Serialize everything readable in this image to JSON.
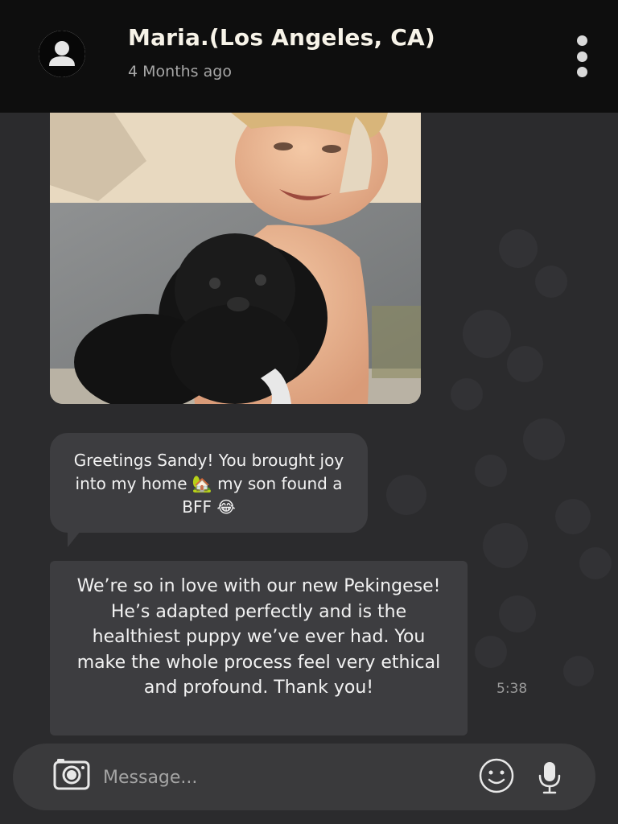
{
  "header": {
    "contact_name": "Maria.(Los Angeles, CA)",
    "last_seen": "4 Months ago",
    "avatar_icon": "person-silhouette-icon",
    "menu_icon": "vertical-ellipsis-icon"
  },
  "messages": [
    {
      "type": "image",
      "description_icon": "photo-attachment"
    },
    {
      "type": "text",
      "text": "Greetings Sandy! You brought joy into my home 🏡 my son found a BFF 😂"
    },
    {
      "type": "text",
      "text": "We’re so in love with our new Pekingese! He’s adapted perfectly and is the healthiest puppy we’ve ever had. You make the whole process feel very ethical and profound. Thank you!",
      "time": "5:38"
    }
  ],
  "composer": {
    "placeholder": "Message...",
    "camera_icon": "camera-icon",
    "emoji_icon": "smiley-icon",
    "mic_icon": "microphone-icon"
  },
  "colors": {
    "background": "#2b2b2d",
    "header": "#0e0e0e",
    "bubble": "#3d3d40",
    "input_bar": "#3a3a3c"
  }
}
